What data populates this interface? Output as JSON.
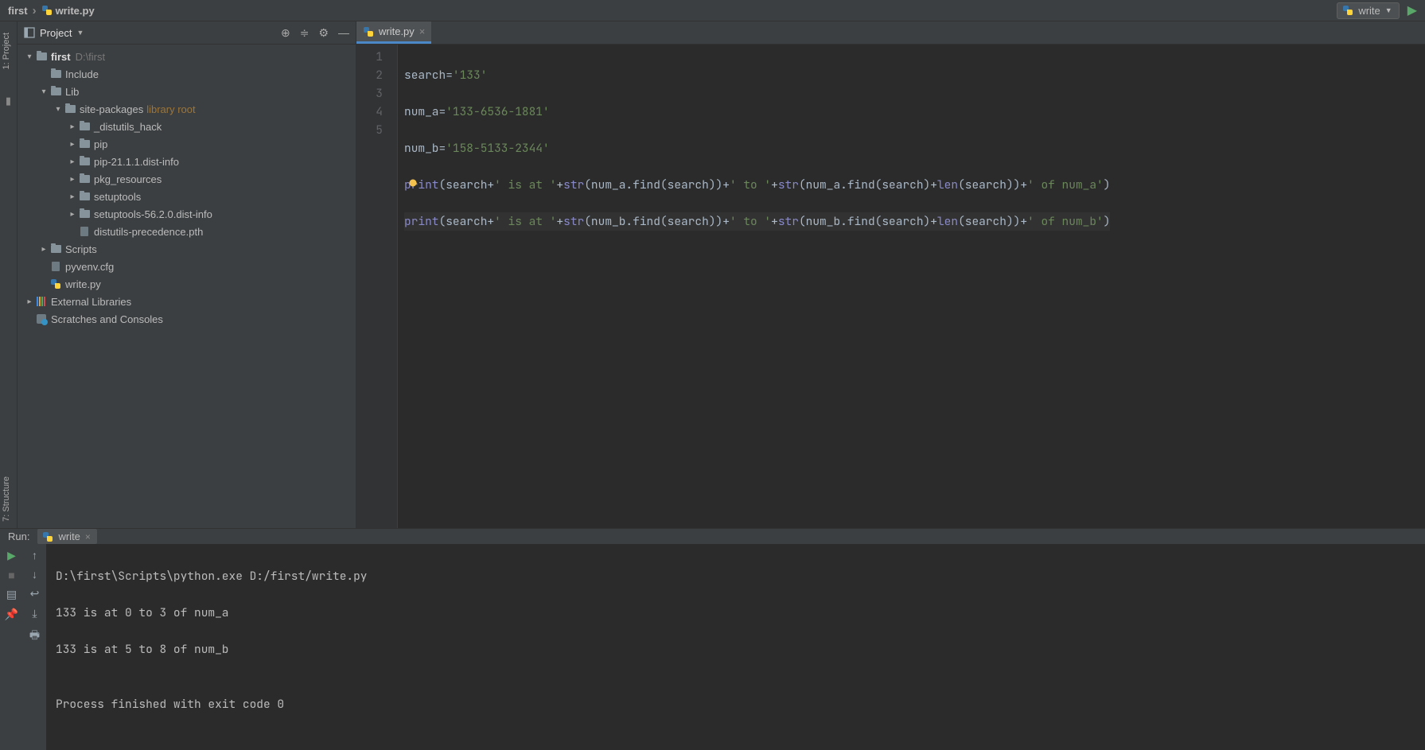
{
  "breadcrumb": {
    "project": "first",
    "file": "write.py"
  },
  "runconfig": {
    "label": "write"
  },
  "project_panel": {
    "title": "Project",
    "root_name": "first",
    "root_path": "D:\\first",
    "include": "Include",
    "lib": "Lib",
    "site_packages": "site-packages",
    "site_packages_hint": "library root",
    "sp": {
      "distutils_hack": "_distutils_hack",
      "pip": "pip",
      "pip_dist": "pip-21.1.1.dist-info",
      "pkg_resources": "pkg_resources",
      "setuptools": "setuptools",
      "setuptools_dist": "setuptools-56.2.0.dist-info",
      "distutils_precedence": "distutils-precedence.pth"
    },
    "scripts": "Scripts",
    "pyvenv": "pyvenv.cfg",
    "writepy": "write.py",
    "external_libraries": "External Libraries",
    "scratches": "Scratches and Consoles"
  },
  "editor": {
    "tab_label": "write.py",
    "lines": {
      "l1a": "search",
      "l1eq": "=",
      "l1s": "'133'",
      "l2a": "num_a",
      "l2eq": "=",
      "l2s": "'133-6536-1881'",
      "l3a": "num_b",
      "l3eq": "=",
      "l3s": "'158-5133-2344'",
      "l4_print": "print",
      "l4_p1": "(search+",
      "l4_s1": "' is at '",
      "l4_p2": "+",
      "l4_str1": "str",
      "l4_p3": "(num_a.find(search))+",
      "l4_s2": "' to '",
      "l4_p4": "+",
      "l4_str2": "str",
      "l4_p5": "(num_a.find(search)+",
      "l4_len": "len",
      "l4_p6": "(search))+",
      "l4_s3": "' of num_a'",
      "l4_p7": ")",
      "l5_print": "print",
      "l5_p1": "(search+",
      "l5_s1": "' is at '",
      "l5_p2": "+",
      "l5_str1": "str",
      "l5_p3": "(num_b.find(search))+",
      "l5_s2": "' to '",
      "l5_p4": "+",
      "l5_str2": "str",
      "l5_p5": "(num_b.find(search)+",
      "l5_len": "len",
      "l5_p6": "(search))+",
      "l5_s3": "' of num_b'",
      "l5_p7": ")"
    },
    "gutter": {
      "n1": "1",
      "n2": "2",
      "n3": "3",
      "n4": "4",
      "n5": "5"
    }
  },
  "run": {
    "label": "Run:",
    "tab": "write",
    "out1": "D:\\first\\Scripts\\python.exe D:/first/write.py",
    "out2": "133 is at 0 to 3 of num_a",
    "out3": "133 is at 5 to 8 of num_b",
    "out4": "",
    "out5": "Process finished with exit code 0"
  },
  "sidetabs": {
    "project": "1: Project",
    "structure": "7: Structure"
  }
}
